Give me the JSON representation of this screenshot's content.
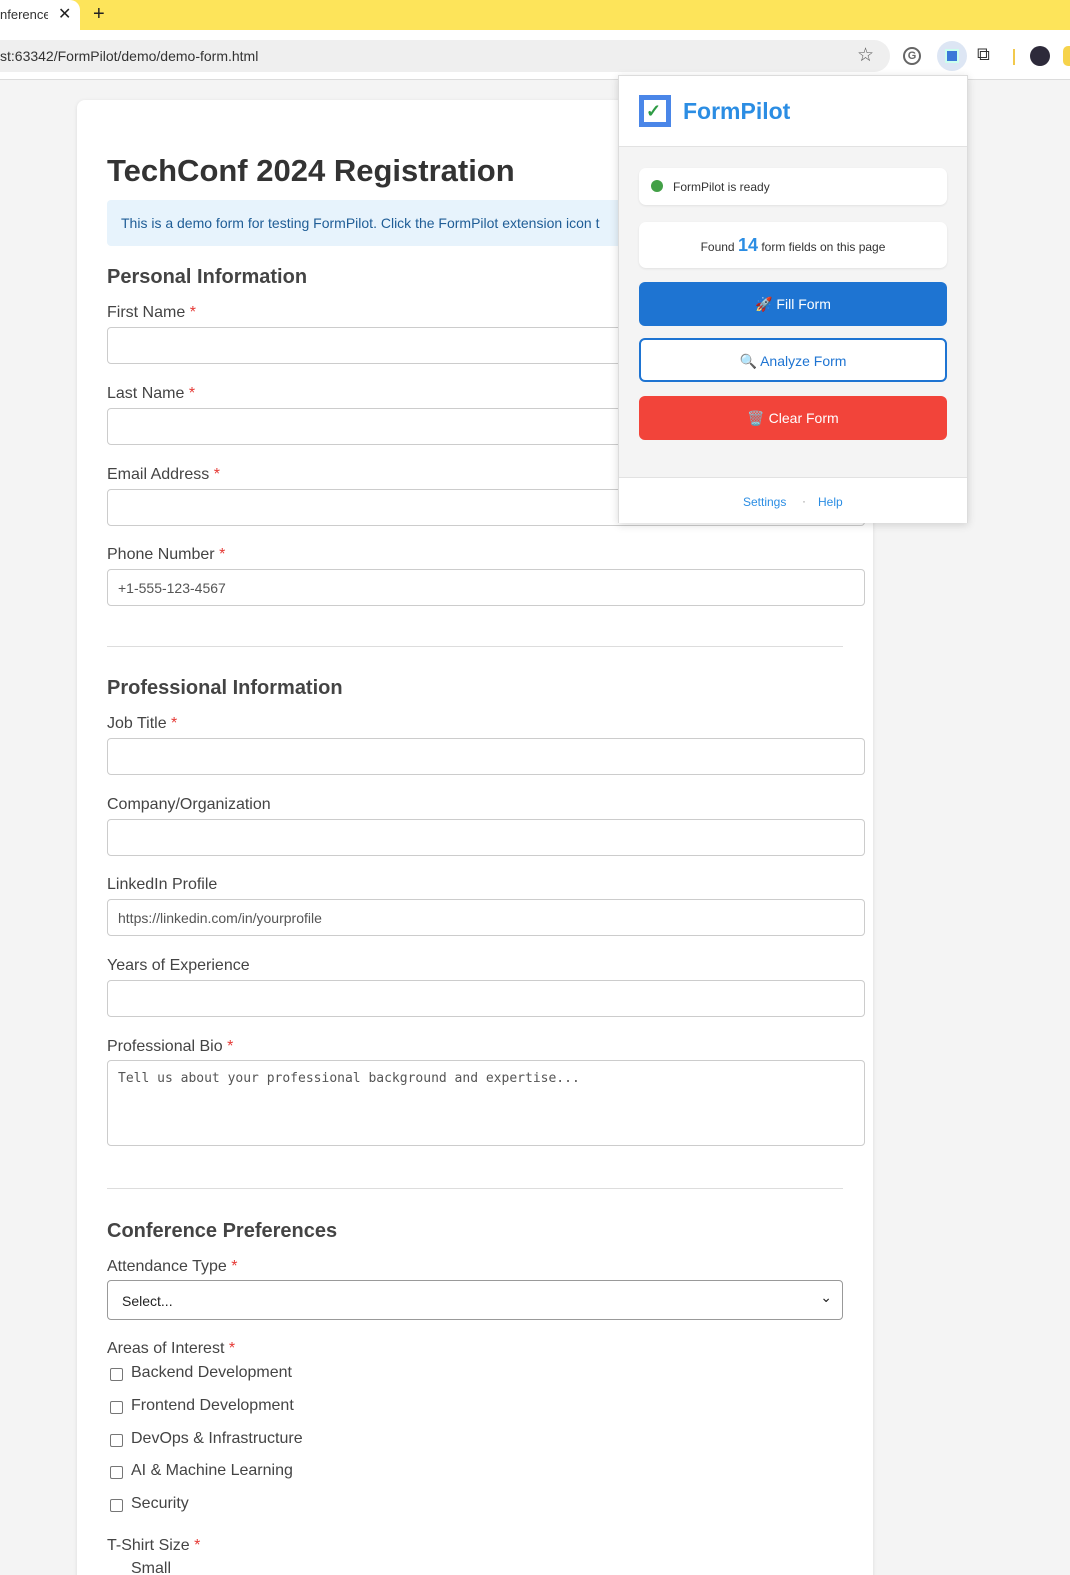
{
  "browser": {
    "tab_title": "nference",
    "tab_close": "✕",
    "new_tab": "+",
    "url": "st:63342/FormPilot/demo/demo-form.html",
    "star": "☆",
    "extensions_icon": "⧉"
  },
  "page": {
    "title": "TechConf 2024 Registration",
    "info": "This is a demo form for testing FormPilot. Click the FormPilot extension icon t",
    "required_mark": "*",
    "sections": {
      "personal": "Personal Information",
      "professional": "Professional Information",
      "preferences": "Conference Preferences"
    },
    "fields": {
      "first_name": "First Name",
      "last_name": "Last Name",
      "email": "Email Address",
      "phone": "Phone Number",
      "phone_placeholder": "+1-555-123-4567",
      "job_title": "Job Title",
      "company": "Company/Organization",
      "linkedin": "LinkedIn Profile",
      "linkedin_placeholder": "https://linkedin.com/in/yourprofile",
      "experience": "Years of Experience",
      "bio": "Professional Bio",
      "bio_placeholder": "Tell us about your professional background and expertise...",
      "attendance": "Attendance Type",
      "attendance_value": "Select...",
      "interests": "Areas of Interest",
      "tshirt": "T-Shirt Size",
      "tshirt_option_partial": "Small"
    },
    "interests": [
      "Backend Development",
      "Frontend Development",
      "DevOps & Infrastructure",
      "AI & Machine Learning",
      "Security"
    ]
  },
  "popup": {
    "brand": "FormPilot",
    "status": "FormPilot is ready",
    "found_prefix": "Found",
    "found_count": "14",
    "found_suffix": "form fields on this page",
    "fill_label": "🚀 Fill Form",
    "analyze_label": "🔍 Analyze Form",
    "clear_label": "🗑️ Clear Form",
    "settings": "Settings",
    "dot": "·",
    "help": "Help",
    "colors": {
      "primary": "#1e74d2",
      "danger": "#f2443a",
      "ready": "#43a047",
      "brand": "#2b8de3"
    }
  }
}
